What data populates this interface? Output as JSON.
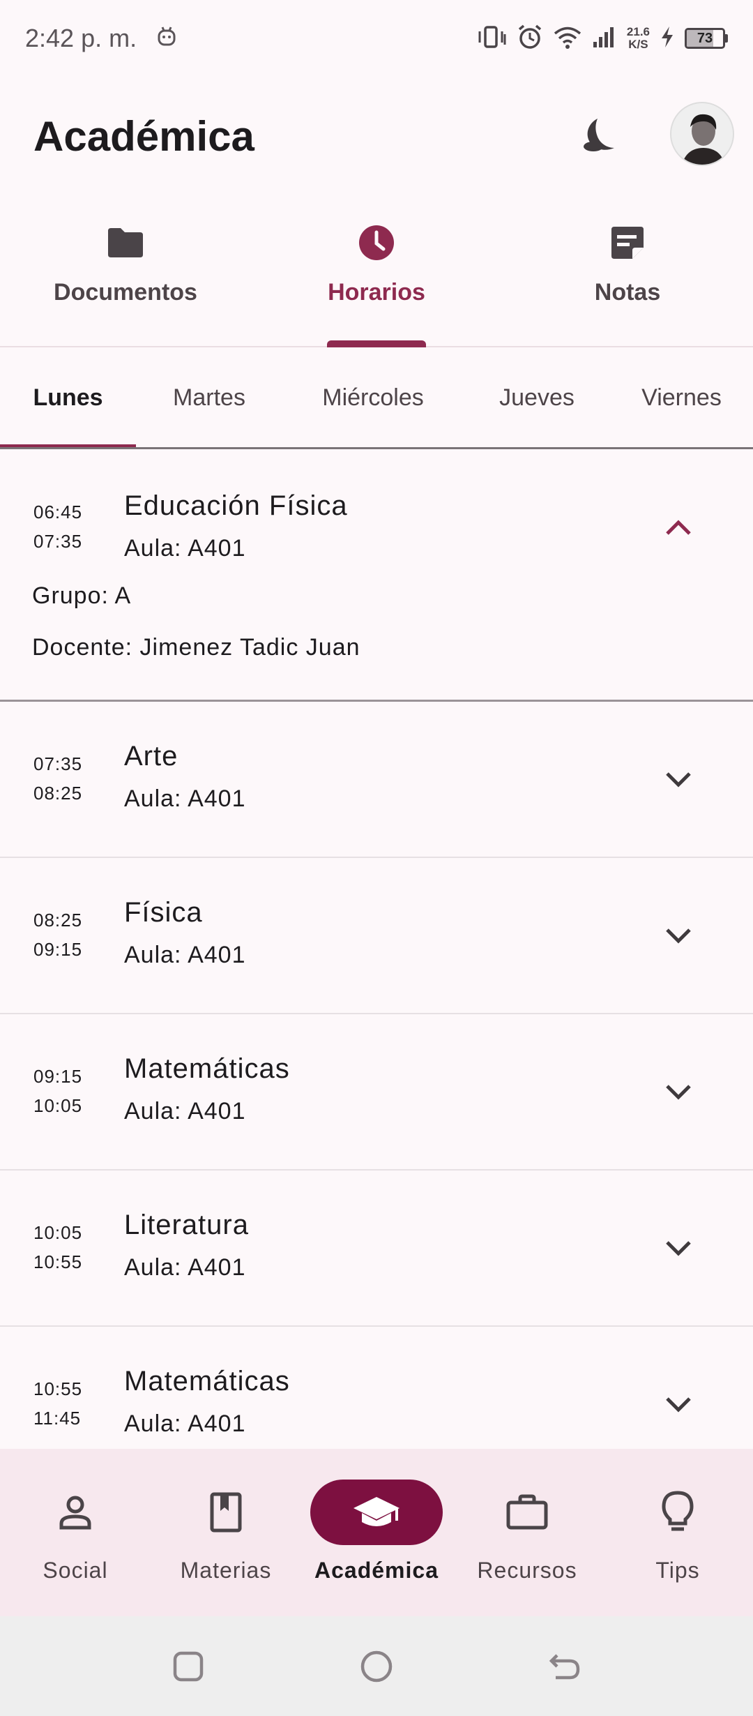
{
  "status_bar": {
    "time": "2:42 p. m.",
    "net_speed_value": "21.6",
    "net_speed_unit": "K/S",
    "battery_percent": 73,
    "battery_label": "73"
  },
  "app_bar": {
    "title": "Académica"
  },
  "top_tabs": [
    {
      "label": "Documentos",
      "icon": "folder-icon",
      "active": false
    },
    {
      "label": "Horarios",
      "icon": "clock-icon",
      "active": true
    },
    {
      "label": "Notas",
      "icon": "note-icon",
      "active": false
    }
  ],
  "day_tabs": [
    {
      "label": "Lunes",
      "active": true
    },
    {
      "label": "Martes",
      "active": false
    },
    {
      "label": "Miércoles",
      "active": false
    },
    {
      "label": "Jueves",
      "active": false
    },
    {
      "label": "Viernes",
      "active": false
    }
  ],
  "schedule": [
    {
      "start": "06:45",
      "end": "07:35",
      "subject": "Educación Física",
      "room": "Aula: A401",
      "expanded": true,
      "group": "Grupo: A",
      "teacher": "Docente: Jimenez Tadic Juan"
    },
    {
      "start": "07:35",
      "end": "08:25",
      "subject": "Arte",
      "room": "Aula: A401",
      "expanded": false
    },
    {
      "start": "08:25",
      "end": "09:15",
      "subject": "Física",
      "room": "Aula: A401",
      "expanded": false
    },
    {
      "start": "09:15",
      "end": "10:05",
      "subject": "Matemáticas",
      "room": "Aula: A401",
      "expanded": false
    },
    {
      "start": "10:05",
      "end": "10:55",
      "subject": "Literatura",
      "room": "Aula: A401",
      "expanded": false
    },
    {
      "start": "10:55",
      "end": "11:45",
      "subject": "Matemáticas",
      "room": "Aula: A401",
      "expanded": false
    }
  ],
  "bottom_nav": [
    {
      "label": "Social",
      "icon": "person-icon",
      "active": false
    },
    {
      "label": "Materias",
      "icon": "book-icon",
      "active": false
    },
    {
      "label": "Académica",
      "icon": "graduation-cap-icon",
      "active": true
    },
    {
      "label": "Recursos",
      "icon": "briefcase-icon",
      "active": false
    },
    {
      "label": "Tips",
      "icon": "lightbulb-icon",
      "active": false
    }
  ],
  "colors": {
    "accent": "#8e2a4f",
    "nav_active_pill": "#7d1040",
    "nav_background": "#f7e8ee",
    "background": "#fdf8fa"
  }
}
